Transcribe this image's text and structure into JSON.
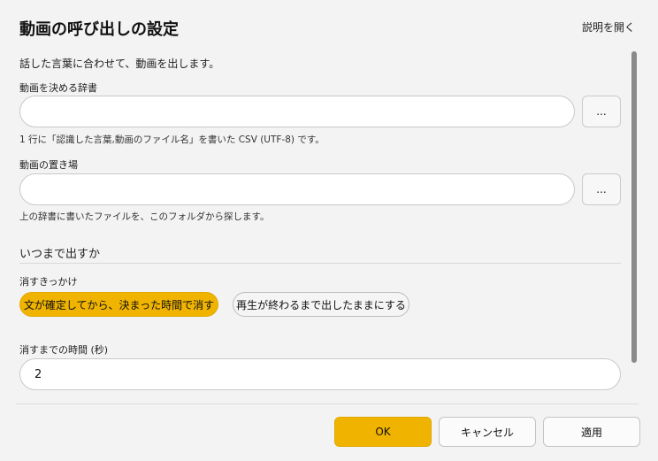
{
  "dialog": {
    "title": "動画の呼び出しの設定",
    "help_link": "説明を開く",
    "description": "話した言葉に合わせて、動画を出します。"
  },
  "dictionary": {
    "label": "動画を決める辞書",
    "value": "",
    "browse_label": "...",
    "hint": "1 行に「認識した言葉,動画のファイル名」を書いた CSV (UTF-8) です。"
  },
  "folder": {
    "label": "動画の置き場",
    "value": "",
    "browse_label": "...",
    "hint": "上の辞書に書いたファイルを、このフォルダから探します。"
  },
  "duration_section": {
    "heading": "いつまで出すか",
    "trigger_label": "消すきっかけ",
    "options": [
      {
        "label": "文が確定してから、決まった時間で消す",
        "selected": true
      },
      {
        "label": "再生が終わるまで出したままにする",
        "selected": false
      }
    ],
    "seconds_label": "消すまでの時間 (秒)",
    "seconds_value": "2"
  },
  "footer": {
    "ok_label": "OK",
    "cancel_label": "キャンセル",
    "apply_label": "適用"
  },
  "colors": {
    "accent": "#f0b400",
    "background": "#f3f3f3"
  }
}
